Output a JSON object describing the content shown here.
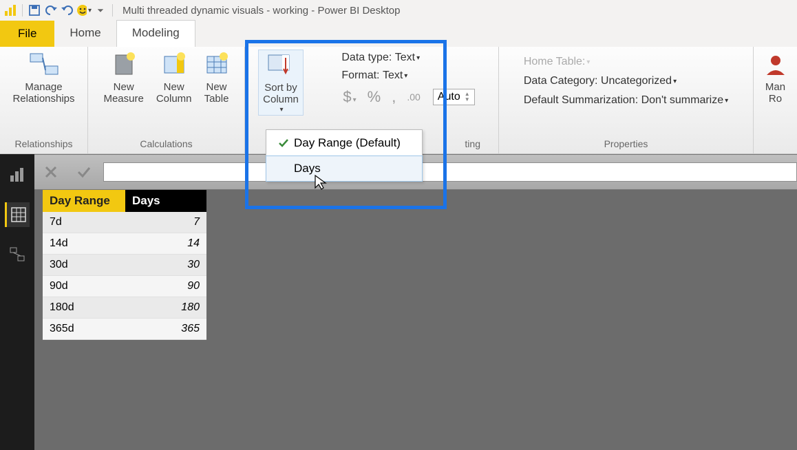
{
  "titlebar": {
    "app_title": "Multi threaded dynamic visuals - working - Power BI Desktop"
  },
  "tabs": {
    "file": "File",
    "home": "Home",
    "modeling": "Modeling"
  },
  "ribbon": {
    "manage_relationships": "Manage\nRelationships",
    "relationships_group": "Relationships",
    "new_measure": "New\nMeasure",
    "new_column": "New\nColumn",
    "new_table": "New\nTable",
    "calculations_group": "Calculations",
    "sort_by_column": "Sort by\nColumn",
    "data_type_label": "Data type:",
    "data_type_value": "Text",
    "format_label": "Format:",
    "format_value": "Text",
    "auto_label": "Auto",
    "formatting_group_partial": "ting",
    "home_table_label": "Home Table:",
    "data_category_label": "Data Category:",
    "data_category_value": "Uncategorized",
    "default_summarization_label": "Default Summarization:",
    "default_summarization_value": "Don't summarize",
    "properties_group": "Properties",
    "manage_roles": "Man\nRo"
  },
  "dropdown": {
    "items": [
      {
        "label": "Day Range (Default)",
        "checked": true
      },
      {
        "label": "Days",
        "checked": false
      }
    ]
  },
  "table": {
    "headers": {
      "col1": "Day Range",
      "col2": "Days"
    },
    "rows": [
      {
        "r": "7d",
        "d": "7"
      },
      {
        "r": "14d",
        "d": "14"
      },
      {
        "r": "30d",
        "d": "30"
      },
      {
        "r": "90d",
        "d": "90"
      },
      {
        "r": "180d",
        "d": "180"
      },
      {
        "r": "365d",
        "d": "365"
      }
    ]
  }
}
